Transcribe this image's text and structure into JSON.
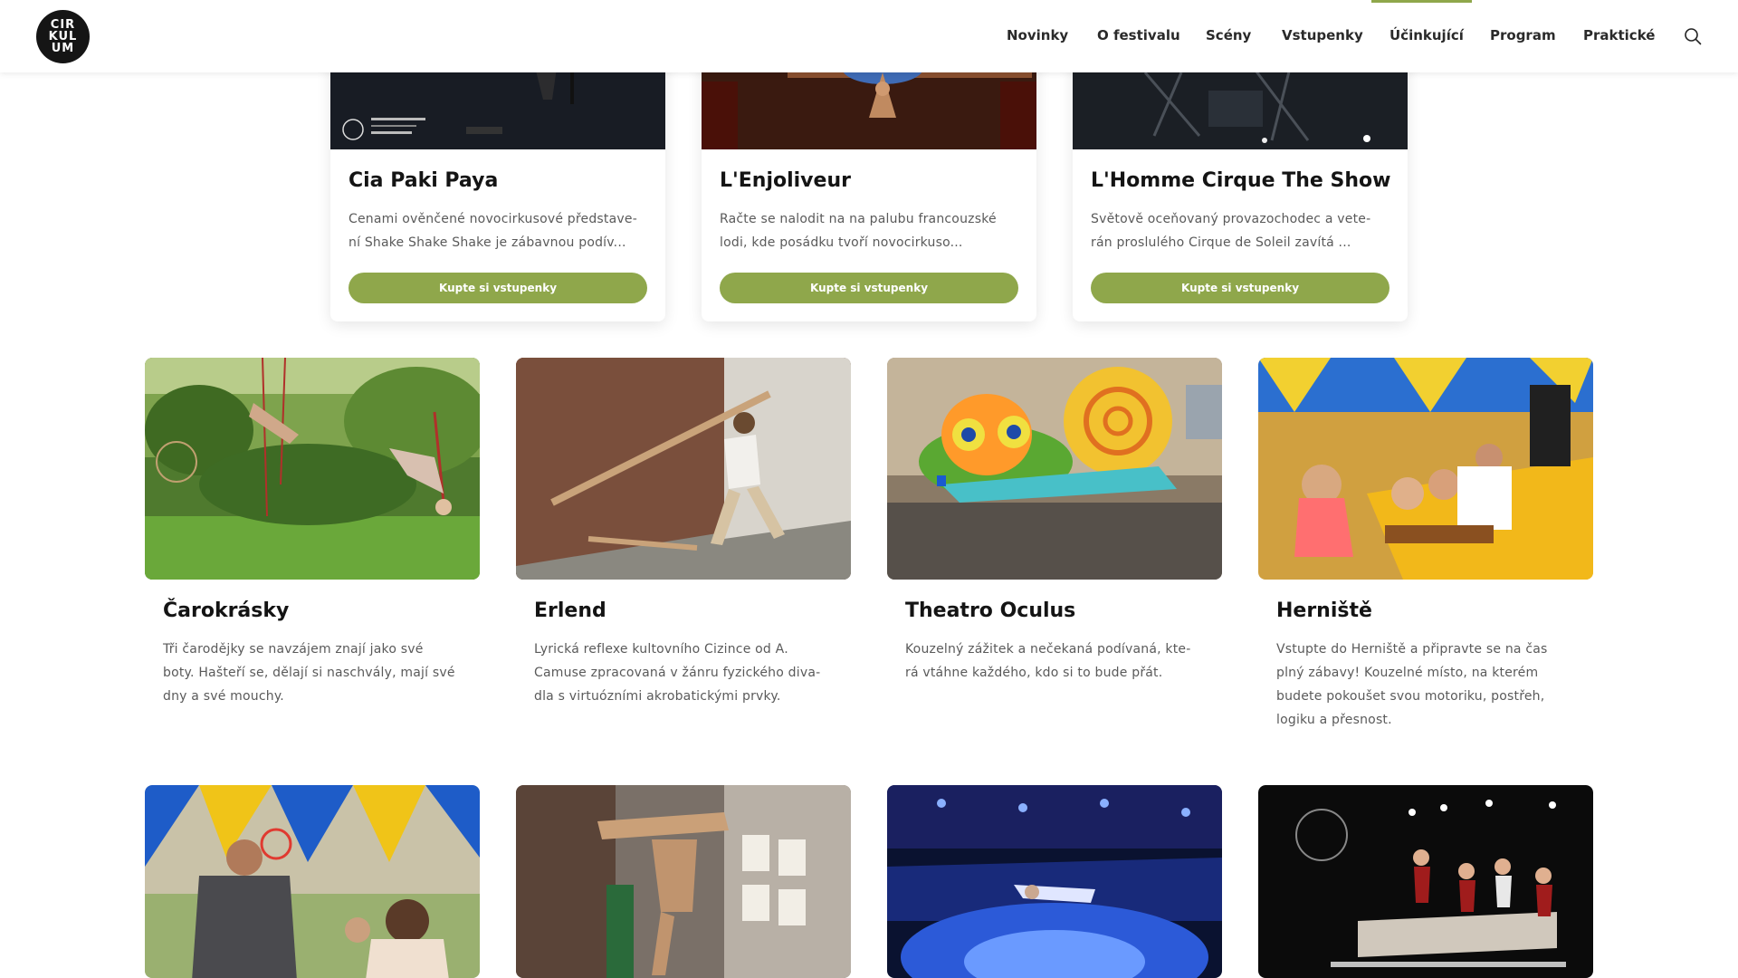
{
  "logo": {
    "lines": [
      "CIR",
      "KUL",
      "UM"
    ]
  },
  "nav": {
    "items": [
      "Novinky",
      "O festivalu",
      "Scény",
      "Vstupenky",
      "Účinkující",
      "Program",
      "Praktické"
    ],
    "active": "Účinkující"
  },
  "colors": {
    "accent": "#8fa74b",
    "logo_bg": "#151515"
  },
  "icons": {
    "search": "search-icon"
  },
  "featured_cards": [
    {
      "title": "Cia Paki Paya",
      "text_lines": [
        "Cenami ověnčené novocirkusové představe-",
        "ní Shake Shake Shake je zábavnou podív..."
      ],
      "button": "Kupte si vstupenky"
    },
    {
      "title": "L'Enjoliveur",
      "text_lines": [
        "Račte se nalodit na na palubu francouzské",
        "lodi, kde posádku tvoří novocirkuso..."
      ],
      "button": "Kupte si vstupenky"
    },
    {
      "title": "L'Homme Cirque The Show",
      "text_lines": [
        "Světově oceňovaný provazochodec a vete-",
        "rán proslulého Cirque de Soleil zavítá ..."
      ],
      "button": "Kupte si vstupenky"
    }
  ],
  "performer_cards": [
    {
      "title": "Čarokrásky",
      "text_lines": [
        "Tři čarodějky se navzájem znají jako své",
        "boty. Hašteří se, dělají si naschvály, mají své",
        "dny a své mouchy."
      ]
    },
    {
      "title": "Erlend",
      "text_lines": [
        "Lyrická reflexe kultovního Cizince od A.",
        "Camuse zpracovaná v žánru fyzického diva-",
        "dla s virtuózními akrobatickými prvky."
      ]
    },
    {
      "title": "Theatro Oculus",
      "text_lines": [
        "Kouzelný zážitek a nečekaná podívaná, kte-",
        "rá vtáhne každého, kdo si to bude přát."
      ]
    },
    {
      "title": "Herniště",
      "text_lines": [
        "Vstupte do Herniště a připravte se na čas",
        "plný zábavy! Kouzelné místo, na kterém",
        "budete pokoušet svou motoriku, postřeh,",
        "logiku a přesnost."
      ]
    }
  ]
}
